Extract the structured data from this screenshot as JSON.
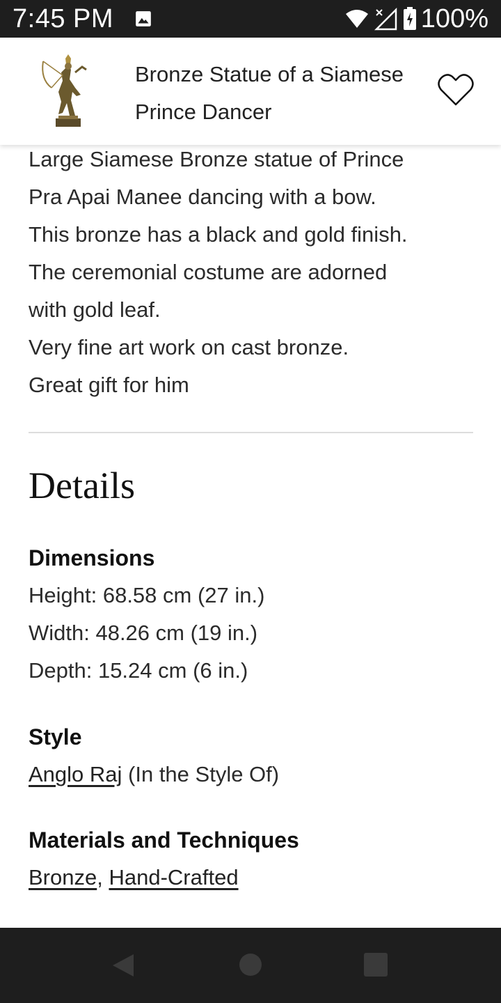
{
  "status_bar": {
    "time": "7:45 PM",
    "battery": "100%",
    "icons": [
      "image-icon",
      "wifi-icon",
      "no-signal-icon",
      "battery-charging-icon"
    ]
  },
  "header": {
    "title": "Bronze Statue of a Siamese Prince Dancer",
    "thumbnail_icon": "statue-thumbnail",
    "favorite_icon": "heart-outline-icon"
  },
  "description": {
    "lines": [
      "Large Siamese Bronze statue of Prince",
      "Pra Apai Manee dancing with a bow.",
      "This bronze has a black and gold finish.",
      "The ceremonial costume are adorned",
      "with gold leaf.",
      "Very fine art work on cast bronze.",
      "Great gift for him"
    ]
  },
  "details": {
    "heading": "Details",
    "dimensions": {
      "label": "Dimensions",
      "height": "Height: 68.58 cm (27 in.)",
      "width": "Width: 48.26 cm (19 in.)",
      "depth": "Depth: 15.24 cm (6 in.)"
    },
    "style": {
      "label": "Style",
      "link": "Anglo Raj",
      "suffix": " (In the Style Of)"
    },
    "materials": {
      "label": "Materials and Techniques",
      "link1": "Bronze",
      "separator": ", ",
      "link2": "Hand-Crafted"
    }
  },
  "nav_bar": {
    "icons": [
      "back-icon",
      "home-icon",
      "recents-icon"
    ]
  },
  "colors": {
    "system_bar": "#1e1e1e",
    "text": "#222222",
    "divider": "#dddddd"
  }
}
